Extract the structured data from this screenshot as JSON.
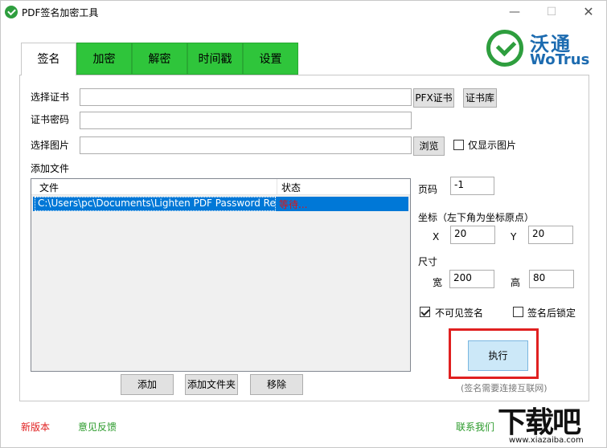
{
  "window": {
    "title": "PDF签名加密工具",
    "minimize": "—",
    "maximize": "☐",
    "close": "✕"
  },
  "logo": {
    "cn": "沃通",
    "en": "WoTrus"
  },
  "tabs": [
    {
      "label": "签名",
      "active": true
    },
    {
      "label": "加密",
      "active": false
    },
    {
      "label": "解密",
      "active": false
    },
    {
      "label": "时间戳",
      "active": false
    },
    {
      "label": "设置",
      "active": false
    }
  ],
  "form": {
    "cert_label": "选择证书",
    "cert_value": "",
    "pfx_button": "PFX证书",
    "store_button": "证书库",
    "password_label": "证书密码",
    "password_value": "",
    "image_label": "选择图片",
    "image_value": "",
    "browse_button": "浏览",
    "only_image_label": "仅显示图片",
    "only_image_checked": false,
    "add_file_label": "添加文件"
  },
  "file_list": {
    "columns": [
      "文件",
      "状态"
    ],
    "rows": [
      {
        "file": "C:\\Users\\pc\\Documents\\Lighten PDF Password Ren",
        "status": "等待..."
      }
    ]
  },
  "list_buttons": {
    "add": "添加",
    "add_folder": "添加文件夹",
    "remove": "移除"
  },
  "side": {
    "page_label": "页码",
    "page_value": "-1",
    "coord_label": "坐标（左下角为坐标原点）",
    "x_label": "X",
    "x_value": "20",
    "y_label": "Y",
    "y_value": "20",
    "size_label": "尺寸",
    "width_label": "宽",
    "width_value": "200",
    "height_label": "高",
    "height_value": "80",
    "invisible_label": "不可见签名",
    "invisible_checked": true,
    "lock_label": "签名后锁定",
    "lock_checked": false,
    "execute_button": "执行",
    "note": "(签名需要连接互联网)"
  },
  "footer": {
    "new_version": "新版本",
    "feedback": "意见反馈",
    "contact": "联系我们"
  },
  "watermark": {
    "big": "下载吧",
    "small": "www.xiazaiba.com"
  },
  "colors": {
    "tab_green": "#2fc53b",
    "selection_blue": "#0078d7",
    "status_red": "#e21313",
    "highlight_red": "#e02020",
    "logo_blue": "#1c6bb0"
  }
}
